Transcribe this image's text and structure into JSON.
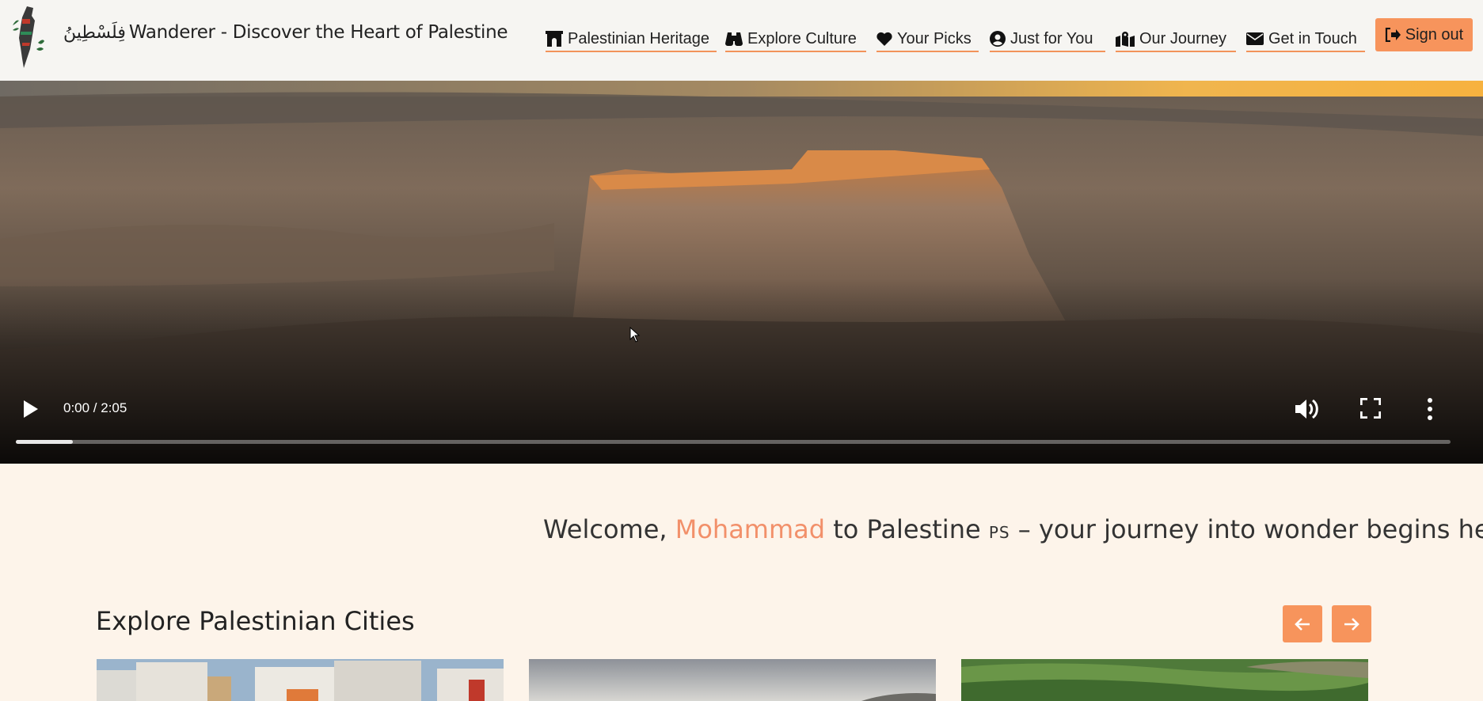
{
  "header": {
    "brand_arabic": "فِلَسْطِينُ",
    "brand_title": "Wanderer - Discover the Heart of Palestine",
    "nav": [
      {
        "label": "Palestinian Heritage",
        "icon": "archway-icon"
      },
      {
        "label": "Explore Culture",
        "icon": "binoculars-icon"
      },
      {
        "label": "Your Picks",
        "icon": "heart-icon"
      },
      {
        "label": "Just for You",
        "icon": "user-circle-icon"
      },
      {
        "label": "Our Journey",
        "icon": "map-marked-icon"
      },
      {
        "label": "Get in Touch",
        "icon": "envelope-icon"
      }
    ],
    "signout_label": "Sign out"
  },
  "video": {
    "time": "0:00 / 2:05",
    "progress": 0.04
  },
  "welcome": {
    "prefix": "Welcome, ",
    "name": "Mohammad",
    "middle": " to Palestine ",
    "country_code": "PS",
    "suffix": " – your journey into wonder begins here"
  },
  "cities": {
    "title": "Explore Palestinian Cities"
  },
  "colors": {
    "accent": "#f7945c",
    "name": "#f2906a",
    "background": "#fdf4ea",
    "header": "#f6f5f2"
  }
}
